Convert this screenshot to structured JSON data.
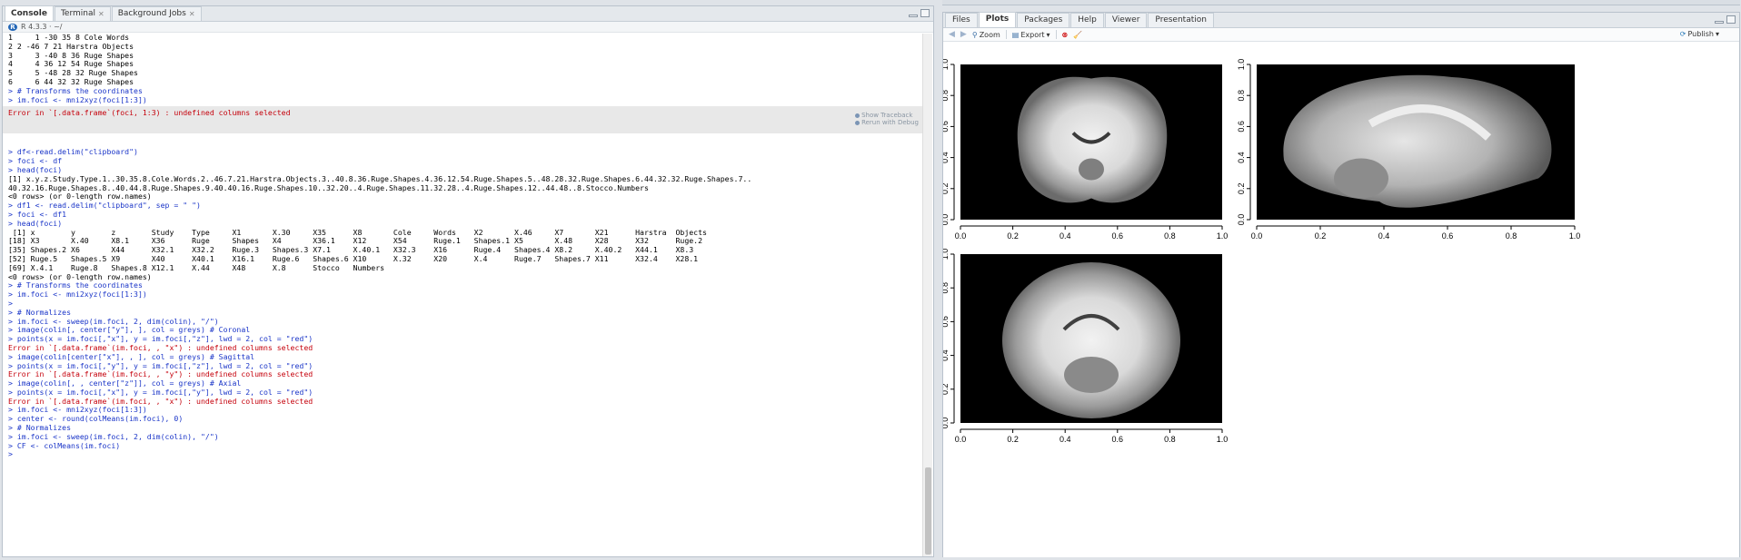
{
  "console_pane": {
    "tabs": [
      {
        "label": "Console",
        "closable": false
      },
      {
        "label": "Terminal",
        "closable": true
      },
      {
        "label": "Background Jobs",
        "closable": true
      }
    ],
    "r_version": "R 4.3.3 · ~/",
    "lines_top": [
      {
        "t": "out",
        "text": "1     1 -30 35 8 Cole Words"
      },
      {
        "t": "out",
        "text": "2 2 -46 7 21 Harstra Objects"
      },
      {
        "t": "out",
        "text": "3     3 -40 8 36 Ruge Shapes"
      },
      {
        "t": "out",
        "text": "4     4 36 12 54 Ruge Shapes"
      },
      {
        "t": "out",
        "text": "5     5 -48 28 32 Ruge Shapes"
      },
      {
        "t": "out",
        "text": "6     6 44 32 32 Ruge Shapes"
      },
      {
        "t": "cmd",
        "text": "> # Transforms the coordinates"
      },
      {
        "t": "cmd",
        "text": "> im.foci <- mni2xyz(foci[1:3])"
      }
    ],
    "error_box": {
      "message": "Error in `[.data.frame`(foci, 1:3) : undefined columns selected",
      "show_traceback": "Show Traceback",
      "rerun_debug": "Rerun with Debug"
    },
    "lines_bottom": [
      {
        "t": "cmd",
        "text": "> df<-read.delim(\"clipboard\")"
      },
      {
        "t": "cmd",
        "text": "> foci <- df"
      },
      {
        "t": "cmd",
        "text": "> head(foci)"
      },
      {
        "t": "out",
        "text": "[1] x.y.z.Study.Type.1..30.35.8.Cole.Words.2..46.7.21.Harstra.Objects.3..40.8.36.Ruge.Shapes.4.36.12.54.Ruge.Shapes.5..48.28.32.Ruge.Shapes.6.44.32.32.Ruge.Shapes.7.."
      },
      {
        "t": "out",
        "text": "40.32.16.Ruge.Shapes.8..40.44.8.Ruge.Shapes.9.40.40.16.Ruge.Shapes.10..32.20..4.Ruge.Shapes.11.32.28..4.Ruge.Shapes.12..44.48..8.Stocco.Numbers"
      },
      {
        "t": "out",
        "text": "<0 rows> (or 0-length row.names)"
      },
      {
        "t": "cmd",
        "text": "> df1 <- read.delim(\"clipboard\", sep = \" \")"
      },
      {
        "t": "cmd",
        "text": "> foci <- df1"
      },
      {
        "t": "cmd",
        "text": "> head(foci)"
      },
      {
        "t": "out",
        "text": " [1] x        y        z        Study    Type     X1       X.30     X35      X8       Cole     Words    X2       X.46     X7       X21      Harstra  Objects"
      },
      {
        "t": "out",
        "text": "[18] X3       X.40     X8.1     X36      Ruge     Shapes   X4       X36.1    X12      X54      Ruge.1   Shapes.1 X5       X.48     X28      X32      Ruge.2"
      },
      {
        "t": "out",
        "text": "[35] Shapes.2 X6       X44      X32.1    X32.2    Ruge.3   Shapes.3 X7.1     X.40.1   X32.3    X16      Ruge.4   Shapes.4 X8.2     X.40.2   X44.1    X8.3"
      },
      {
        "t": "out",
        "text": "[52] Ruge.5   Shapes.5 X9       X40      X40.1    X16.1    Ruge.6   Shapes.6 X10      X.32     X20      X.4      Ruge.7   Shapes.7 X11      X32.4    X28.1"
      },
      {
        "t": "out",
        "text": "[69] X.4.1    Ruge.8   Shapes.8 X12.1    X.44     X48      X.8      Stocco   Numbers"
      },
      {
        "t": "out",
        "text": "<0 rows> (or 0-length row.names)"
      },
      {
        "t": "cmd",
        "text": "> # Transforms the coordinates"
      },
      {
        "t": "cmd",
        "text": "> im.foci <- mni2xyz(foci[1:3])"
      },
      {
        "t": "cmd",
        "text": ">"
      },
      {
        "t": "cmd",
        "text": "> # Normalizes"
      },
      {
        "t": "cmd",
        "text": "> im.foci <- sweep(im.foci, 2, dim(colin), \"/\")"
      },
      {
        "t": "cmd",
        "text": "> image(colin[, center[\"y\"], ], col = greys) # Coronal"
      },
      {
        "t": "cmd",
        "text": "> points(x = im.foci[,\"x\"], y = im.foci[,\"z\"], lwd = 2, col = \"red\")"
      },
      {
        "t": "err",
        "text": "Error in `[.data.frame`(im.foci, , \"x\") : undefined columns selected"
      },
      {
        "t": "cmd",
        "text": "> image(colin[center[\"x\"], , ], col = greys) # Sagittal"
      },
      {
        "t": "cmd",
        "text": "> points(x = im.foci[,\"y\"], y = im.foci[,\"z\"], lwd = 2, col = \"red\")"
      },
      {
        "t": "err",
        "text": "Error in `[.data.frame`(im.foci, , \"y\") : undefined columns selected"
      },
      {
        "t": "cmd",
        "text": "> image(colin[, , center[\"z\"]], col = greys) # Axial"
      },
      {
        "t": "cmd",
        "text": "> points(x = im.foci[,\"x\"], y = im.foci[,\"y\"], lwd = 2, col = \"red\")"
      },
      {
        "t": "err",
        "text": "Error in `[.data.frame`(im.foci, , \"x\") : undefined columns selected"
      },
      {
        "t": "cmd",
        "text": "> im.foci <- mni2xyz(foci[1:3])"
      },
      {
        "t": "cmd",
        "text": "> center <- round(colMeans(im.foci), 0)"
      },
      {
        "t": "cmd",
        "text": "> # Normalizes"
      },
      {
        "t": "cmd",
        "text": "> im.foci <- sweep(im.foci, 2, dim(colin), \"/\")"
      },
      {
        "t": "cmd",
        "text": "> CF <- colMeans(im.foci)"
      },
      {
        "t": "cmd",
        "text": ">"
      }
    ]
  },
  "plots_pane": {
    "tabs": [
      "Files",
      "Plots",
      "Packages",
      "Help",
      "Viewer",
      "Presentation"
    ],
    "active_tab": "Plots",
    "toolbar": {
      "zoom": "Zoom",
      "export": "Export",
      "publish": "Publish"
    },
    "tick_labels": [
      "0.0",
      "0.2",
      "0.4",
      "0.6",
      "0.8",
      "1.0"
    ]
  },
  "chart_data": [
    {
      "type": "heatmap",
      "name": "coronal",
      "xlim": [
        0,
        1
      ],
      "ylim": [
        0,
        1
      ],
      "xticks": [
        0.0,
        0.2,
        0.4,
        0.6,
        0.8,
        1.0
      ],
      "yticks": [
        0.0,
        0.2,
        0.4,
        0.6,
        0.8,
        1.0
      ],
      "colormap": "greys"
    },
    {
      "type": "heatmap",
      "name": "sagittal",
      "xlim": [
        0,
        1
      ],
      "ylim": [
        0,
        1
      ],
      "xticks": [
        0.0,
        0.2,
        0.4,
        0.6,
        0.8,
        1.0
      ],
      "yticks": [
        0.0,
        0.2,
        0.4,
        0.6,
        0.8,
        1.0
      ],
      "colormap": "greys"
    },
    {
      "type": "heatmap",
      "name": "axial",
      "xlim": [
        0,
        1
      ],
      "ylim": [
        0,
        1
      ],
      "xticks": [
        0.0,
        0.2,
        0.4,
        0.6,
        0.8,
        1.0
      ],
      "yticks": [
        0.0,
        0.2,
        0.4,
        0.6,
        0.8,
        1.0
      ],
      "colormap": "greys"
    }
  ],
  "colors": {
    "command": "#1a35c8",
    "error": "#c5000b",
    "output": "#000000",
    "plot_background": "#000000"
  }
}
